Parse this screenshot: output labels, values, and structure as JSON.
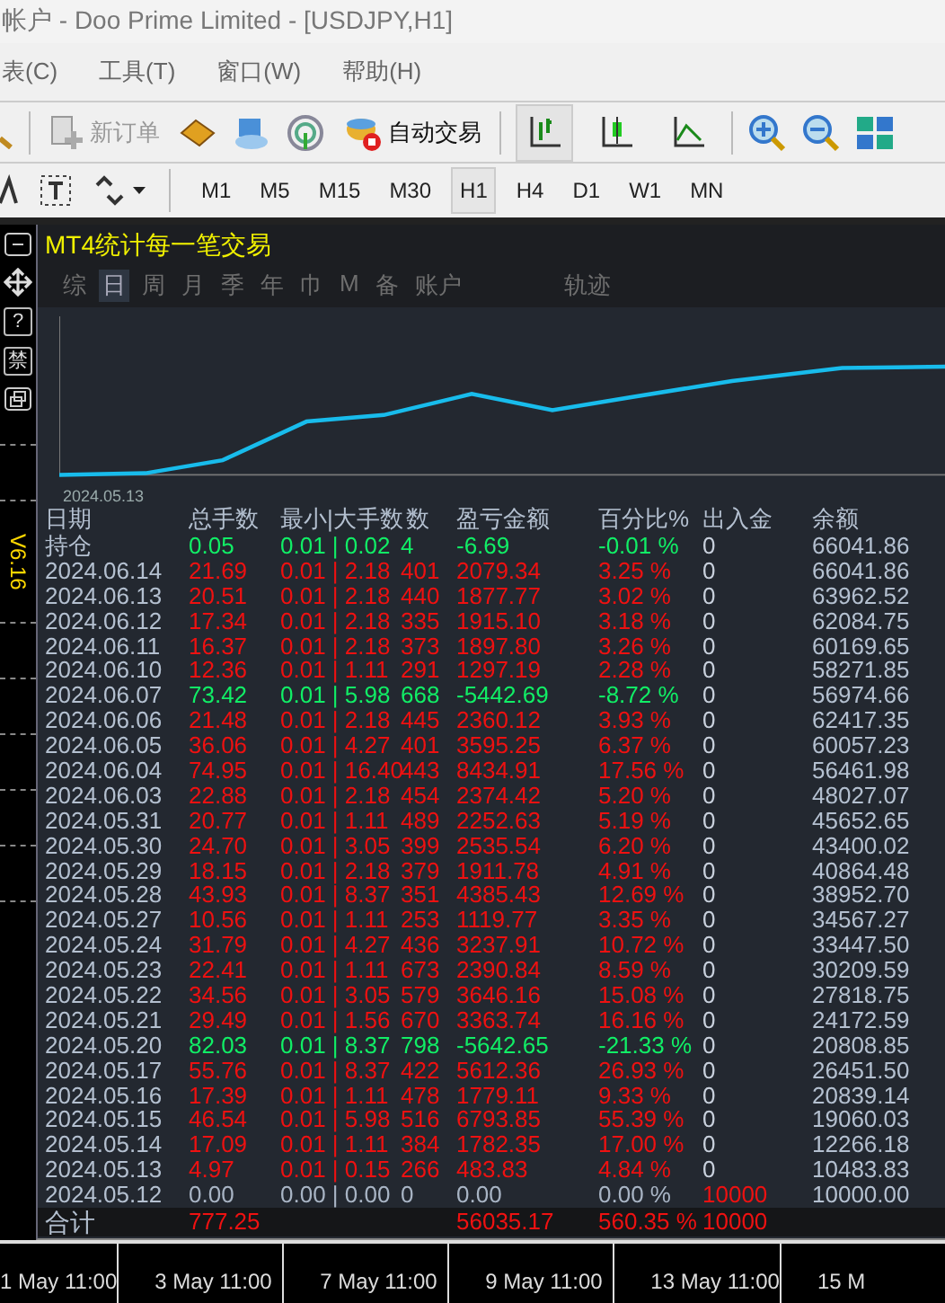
{
  "window": {
    "title": "帐户 - Doo Prime Limited - [USDJPY,H1]"
  },
  "menu": [
    "表(C)",
    "工具(T)",
    "窗口(W)",
    "帮助(H)"
  ],
  "toolbar": {
    "new_order": {
      "label": "新订单",
      "disabled": true
    },
    "auto_trading": {
      "label": "自动交易"
    },
    "chart_modes": [
      {
        "kind": "bars",
        "selected": true
      },
      {
        "kind": "candles",
        "selected": false
      },
      {
        "kind": "line",
        "selected": false
      }
    ]
  },
  "timeframes": [
    {
      "label": "M1",
      "selected": false
    },
    {
      "label": "M5",
      "selected": false
    },
    {
      "label": "M15",
      "selected": false
    },
    {
      "label": "M30",
      "selected": false
    },
    {
      "label": "H1",
      "selected": true
    },
    {
      "label": "H4",
      "selected": false
    },
    {
      "label": "D1",
      "selected": false
    },
    {
      "label": "W1",
      "selected": false
    },
    {
      "label": "MN",
      "selected": false
    }
  ],
  "side_strip": {
    "help_button": "?",
    "ban_button": "禁",
    "version": "V6.16"
  },
  "panel": {
    "title": "MT4统计每一笔交易",
    "tabs": [
      {
        "label": "综",
        "selected": false
      },
      {
        "label": "日",
        "selected": true
      },
      {
        "label": "周",
        "selected": false
      },
      {
        "label": "月",
        "selected": false
      },
      {
        "label": "季",
        "selected": false
      },
      {
        "label": "年",
        "selected": false
      },
      {
        "label": "巾",
        "selected": false
      },
      {
        "label": "M",
        "selected": false
      },
      {
        "label": "备",
        "selected": false
      },
      {
        "label": "账户",
        "selected": false
      },
      {
        "label": "轨迹",
        "selected": false
      }
    ],
    "chart_start_label": "2024.05.13",
    "columns": [
      "日期",
      "总手数",
      "最小|大手数",
      "数",
      "盈亏金额",
      "百分比%",
      "出入金",
      "余额"
    ],
    "rows": [
      {
        "date": "持仓",
        "total": "0.05",
        "lots": "0.01 | 0.02",
        "count": "4",
        "pl": "-6.69",
        "pct": "-0.01 %",
        "deposit": "0",
        "balance": "66041.86",
        "kind": "loss",
        "deposit_highlight": false
      },
      {
        "date": "2024.06.14",
        "total": "21.69",
        "lots": "0.01 | 2.18",
        "count": "401",
        "pl": "2079.34",
        "pct": "3.25 %",
        "deposit": "0",
        "balance": "66041.86",
        "kind": "profit",
        "deposit_highlight": false
      },
      {
        "date": "2024.06.13",
        "total": "20.51",
        "lots": "0.01 | 2.18",
        "count": "440",
        "pl": "1877.77",
        "pct": "3.02 %",
        "deposit": "0",
        "balance": "63962.52",
        "kind": "profit",
        "deposit_highlight": false
      },
      {
        "date": "2024.06.12",
        "total": "17.34",
        "lots": "0.01 | 2.18",
        "count": "335",
        "pl": "1915.10",
        "pct": "3.18 %",
        "deposit": "0",
        "balance": "62084.75",
        "kind": "profit",
        "deposit_highlight": false
      },
      {
        "date": "2024.06.11",
        "total": "16.37",
        "lots": "0.01 | 2.18",
        "count": "373",
        "pl": "1897.80",
        "pct": "3.26 %",
        "deposit": "0",
        "balance": "60169.65",
        "kind": "profit",
        "deposit_highlight": false
      },
      {
        "date": "2024.06.10",
        "total": "12.36",
        "lots": "0.01 | 1.11",
        "count": "291",
        "pl": "1297.19",
        "pct": "2.28 %",
        "deposit": "0",
        "balance": "58271.85",
        "kind": "profit",
        "deposit_highlight": false
      },
      {
        "date": "2024.06.07",
        "total": "73.42",
        "lots": "0.01 | 5.98",
        "count": "668",
        "pl": "-5442.69",
        "pct": "-8.72 %",
        "deposit": "0",
        "balance": "56974.66",
        "kind": "loss",
        "deposit_highlight": false
      },
      {
        "date": "2024.06.06",
        "total": "21.48",
        "lots": "0.01 | 2.18",
        "count": "445",
        "pl": "2360.12",
        "pct": "3.93 %",
        "deposit": "0",
        "balance": "62417.35",
        "kind": "profit",
        "deposit_highlight": false
      },
      {
        "date": "2024.06.05",
        "total": "36.06",
        "lots": "0.01 | 4.27",
        "count": "401",
        "pl": "3595.25",
        "pct": "6.37 %",
        "deposit": "0",
        "balance": "60057.23",
        "kind": "profit",
        "deposit_highlight": false
      },
      {
        "date": "2024.06.04",
        "total": "74.95",
        "lots": "0.01 | 16.40",
        "count": "443",
        "pl": "8434.91",
        "pct": "17.56 %",
        "deposit": "0",
        "balance": "56461.98",
        "kind": "profit",
        "deposit_highlight": false
      },
      {
        "date": "2024.06.03",
        "total": "22.88",
        "lots": "0.01 | 2.18",
        "count": "454",
        "pl": "2374.42",
        "pct": "5.20 %",
        "deposit": "0",
        "balance": "48027.07",
        "kind": "profit",
        "deposit_highlight": false
      },
      {
        "date": "2024.05.31",
        "total": "20.77",
        "lots": "0.01 | 1.11",
        "count": "489",
        "pl": "2252.63",
        "pct": "5.19 %",
        "deposit": "0",
        "balance": "45652.65",
        "kind": "profit",
        "deposit_highlight": false
      },
      {
        "date": "2024.05.30",
        "total": "24.70",
        "lots": "0.01 | 3.05",
        "count": "399",
        "pl": "2535.54",
        "pct": "6.20 %",
        "deposit": "0",
        "balance": "43400.02",
        "kind": "profit",
        "deposit_highlight": false
      },
      {
        "date": "2024.05.29",
        "total": "18.15",
        "lots": "0.01 | 2.18",
        "count": "379",
        "pl": "1911.78",
        "pct": "4.91 %",
        "deposit": "0",
        "balance": "40864.48",
        "kind": "profit",
        "deposit_highlight": false
      },
      {
        "date": "2024.05.28",
        "total": "43.93",
        "lots": "0.01 | 8.37",
        "count": "351",
        "pl": "4385.43",
        "pct": "12.69 %",
        "deposit": "0",
        "balance": "38952.70",
        "kind": "profit",
        "deposit_highlight": false
      },
      {
        "date": "2024.05.27",
        "total": "10.56",
        "lots": "0.01 | 1.11",
        "count": "253",
        "pl": "1119.77",
        "pct": "3.35 %",
        "deposit": "0",
        "balance": "34567.27",
        "kind": "profit",
        "deposit_highlight": false
      },
      {
        "date": "2024.05.24",
        "total": "31.79",
        "lots": "0.01 | 4.27",
        "count": "436",
        "pl": "3237.91",
        "pct": "10.72 %",
        "deposit": "0",
        "balance": "33447.50",
        "kind": "profit",
        "deposit_highlight": false
      },
      {
        "date": "2024.05.23",
        "total": "22.41",
        "lots": "0.01 | 1.11",
        "count": "673",
        "pl": "2390.84",
        "pct": "8.59 %",
        "deposit": "0",
        "balance": "30209.59",
        "kind": "profit",
        "deposit_highlight": false
      },
      {
        "date": "2024.05.22",
        "total": "34.56",
        "lots": "0.01 | 3.05",
        "count": "579",
        "pl": "3646.16",
        "pct": "15.08 %",
        "deposit": "0",
        "balance": "27818.75",
        "kind": "profit",
        "deposit_highlight": false
      },
      {
        "date": "2024.05.21",
        "total": "29.49",
        "lots": "0.01 | 1.56",
        "count": "670",
        "pl": "3363.74",
        "pct": "16.16 %",
        "deposit": "0",
        "balance": "24172.59",
        "kind": "profit",
        "deposit_highlight": false
      },
      {
        "date": "2024.05.20",
        "total": "82.03",
        "lots": "0.01 | 8.37",
        "count": "798",
        "pl": "-5642.65",
        "pct": "-21.33 %",
        "deposit": "0",
        "balance": "20808.85",
        "kind": "loss",
        "deposit_highlight": false
      },
      {
        "date": "2024.05.17",
        "total": "55.76",
        "lots": "0.01 | 8.37",
        "count": "422",
        "pl": "5612.36",
        "pct": "26.93 %",
        "deposit": "0",
        "balance": "26451.50",
        "kind": "profit",
        "deposit_highlight": false
      },
      {
        "date": "2024.05.16",
        "total": "17.39",
        "lots": "0.01 | 1.11",
        "count": "478",
        "pl": "1779.11",
        "pct": "9.33 %",
        "deposit": "0",
        "balance": "20839.14",
        "kind": "profit",
        "deposit_highlight": false
      },
      {
        "date": "2024.05.15",
        "total": "46.54",
        "lots": "0.01 | 5.98",
        "count": "516",
        "pl": "6793.85",
        "pct": "55.39 %",
        "deposit": "0",
        "balance": "19060.03",
        "kind": "profit",
        "deposit_highlight": false
      },
      {
        "date": "2024.05.14",
        "total": "17.09",
        "lots": "0.01 | 1.11",
        "count": "384",
        "pl": "1782.35",
        "pct": "17.00 %",
        "deposit": "0",
        "balance": "12266.18",
        "kind": "profit",
        "deposit_highlight": false
      },
      {
        "date": "2024.05.13",
        "total": "4.97",
        "lots": "0.01 | 0.15",
        "count": "266",
        "pl": "483.83",
        "pct": "4.84 %",
        "deposit": "0",
        "balance": "10483.83",
        "kind": "profit",
        "deposit_highlight": false
      },
      {
        "date": "2024.05.12",
        "total": "0.00",
        "lots": "0.00 | 0.00",
        "count": "0",
        "pl": "0.00",
        "pct": "0.00 %",
        "deposit": "10000",
        "balance": "10000.00",
        "kind": "flat",
        "deposit_highlight": true
      }
    ],
    "total": {
      "label": "合计",
      "total": "777.25",
      "pl": "56035.17",
      "pct": "560.35 %",
      "deposit": "10000"
    }
  },
  "time_axis": [
    "1 May 11:00",
    "3 May 11:00",
    "7 May 11:00",
    "9 May 11:00",
    "13 May 11:00",
    "15 M"
  ]
}
